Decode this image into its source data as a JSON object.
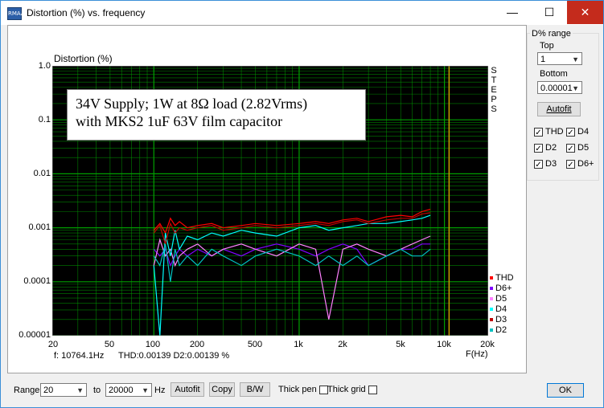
{
  "window": {
    "title": "Distortion (%) vs. frequency",
    "icon_label": "RMAA",
    "buttons": {
      "minimize": "—",
      "maximize": "☐",
      "close": "✕"
    }
  },
  "plot": {
    "y_title": "Distortion (%)",
    "x_title": "F(Hz)",
    "y_ticks": [
      "1.0",
      "0.1",
      "0.01",
      "0.001",
      "0.0001",
      "0.00001"
    ],
    "x_ticks": [
      "20",
      "50",
      "100",
      "200",
      "500",
      "1k",
      "2k",
      "5k",
      "10k",
      "20k"
    ],
    "annotation_line1": "34V Supply; 1W at 8Ω load (2.82Vrms)",
    "annotation_line2": "with MKS2 1uF 63V film capacitor",
    "steps_label": "STEPS",
    "status_freq": "f: 10764.1Hz",
    "status_values": "THD:0.00139   D2:0.00139   %",
    "legend": [
      {
        "label": "THD",
        "color": "#ff0000"
      },
      {
        "label": "D6+",
        "color": "#8000ff"
      },
      {
        "label": "D5",
        "color": "#ff80ff"
      },
      {
        "label": "D4",
        "color": "#00ffff"
      },
      {
        "label": "D3",
        "color": "#c00000"
      },
      {
        "label": "D2",
        "color": "#00c0c0"
      }
    ],
    "background": "#000000",
    "grid_color": "#00a000",
    "marker_color": "#c8a000"
  },
  "chart_data": {
    "type": "line",
    "title": "",
    "xlabel": "F(Hz)",
    "ylabel": "Distortion (%)",
    "x_scale": "log",
    "y_scale": "log",
    "xlim": [
      20,
      20000
    ],
    "ylim": [
      1e-05,
      1.0
    ],
    "grid": true,
    "legend_position": "bottom-right",
    "marker_x": 10764.1,
    "x": [
      100,
      110,
      120,
      130,
      140,
      150,
      170,
      200,
      250,
      300,
      400,
      500,
      700,
      1000,
      1300,
      1600,
      2000,
      2500,
      3000,
      4000,
      5000,
      6000,
      7000,
      8000
    ],
    "series": [
      {
        "name": "THD",
        "color": "#ff0000",
        "values": [
          0.0009,
          0.0012,
          0.0008,
          0.0015,
          0.0011,
          0.0013,
          0.001,
          0.0011,
          0.0012,
          0.001,
          0.0011,
          0.0012,
          0.0011,
          0.0012,
          0.0013,
          0.0012,
          0.0014,
          0.0015,
          0.0013,
          0.0016,
          0.0017,
          0.0016,
          0.002,
          0.0022
        ]
      },
      {
        "name": "D6+",
        "color": "#8000ff",
        "values": [
          0.0004,
          0.0003,
          0.0004,
          0.0002,
          0.0003,
          0.0004,
          0.0003,
          0.0004,
          0.0003,
          0.0004,
          0.0003,
          0.0004,
          0.0005,
          0.0004,
          0.0003,
          0.0004,
          0.0005,
          0.0004,
          0.0002,
          0.0003,
          0.0004,
          0.0004,
          0.0005,
          0.0005
        ]
      },
      {
        "name": "D5",
        "color": "#ff80ff",
        "values": [
          0.0002,
          0.0006,
          0.0003,
          0.0004,
          0.0002,
          0.0003,
          0.0004,
          0.0005,
          0.0003,
          0.0004,
          0.0005,
          0.0004,
          0.0003,
          0.0005,
          0.0004,
          2e-05,
          0.0004,
          0.0005,
          0.0004,
          0.0003,
          0.0004,
          0.0005,
          0.0006,
          0.0007
        ]
      },
      {
        "name": "D4",
        "color": "#00ffff",
        "values": [
          0.0002,
          1e-05,
          0.0008,
          0.0003,
          0.0009,
          0.0004,
          0.0007,
          0.0006,
          0.0008,
          0.0007,
          0.0009,
          0.0008,
          0.0007,
          0.001,
          0.0011,
          0.0009,
          0.001,
          0.0011,
          0.0012,
          0.0012,
          0.0013,
          0.0014,
          0.0015,
          0.0017
        ]
      },
      {
        "name": "D3",
        "color": "#c00000",
        "values": [
          0.0008,
          0.0011,
          0.0005,
          0.0012,
          0.0008,
          0.001,
          0.0009,
          0.001,
          0.0011,
          0.0009,
          0.001,
          0.0011,
          0.001,
          0.0011,
          0.0012,
          0.0011,
          0.0013,
          0.0014,
          0.0012,
          0.0014,
          0.0015,
          0.0015,
          0.0018,
          0.0019
        ]
      },
      {
        "name": "D2",
        "color": "#00c0c0",
        "values": [
          0.0003,
          0.0002,
          0.0005,
          0.0001,
          0.0004,
          0.0002,
          0.0003,
          0.0002,
          0.0004,
          0.0003,
          0.0002,
          0.0003,
          0.0004,
          0.0003,
          0.0002,
          0.0003,
          0.0002,
          0.0003,
          0.0002,
          0.0003,
          0.0004,
          0.0003,
          0.0003,
          0.0004
        ]
      }
    ]
  },
  "side_panel": {
    "group_title": "D% range",
    "top_label": "Top",
    "top_value": "1",
    "bottom_label": "Bottom",
    "bottom_value": "0.00001",
    "autofit_label": "Autofit",
    "checks": [
      {
        "label": "THD",
        "checked": true
      },
      {
        "label": "D4",
        "checked": true
      },
      {
        "label": "D2",
        "checked": true
      },
      {
        "label": "D5",
        "checked": true
      },
      {
        "label": "D3",
        "checked": true
      },
      {
        "label": "D6+",
        "checked": true
      }
    ]
  },
  "bottom": {
    "range_label": "Range:",
    "range_from": "20",
    "to_label": "to",
    "range_to": "20000",
    "hz_label": "Hz",
    "autofit_label": "Autofit",
    "copy_label": "Copy",
    "bw_label": "B/W",
    "thick_pen_label": "Thick pen",
    "thick_grid_label": "Thick grid",
    "ok_label": "OK"
  }
}
